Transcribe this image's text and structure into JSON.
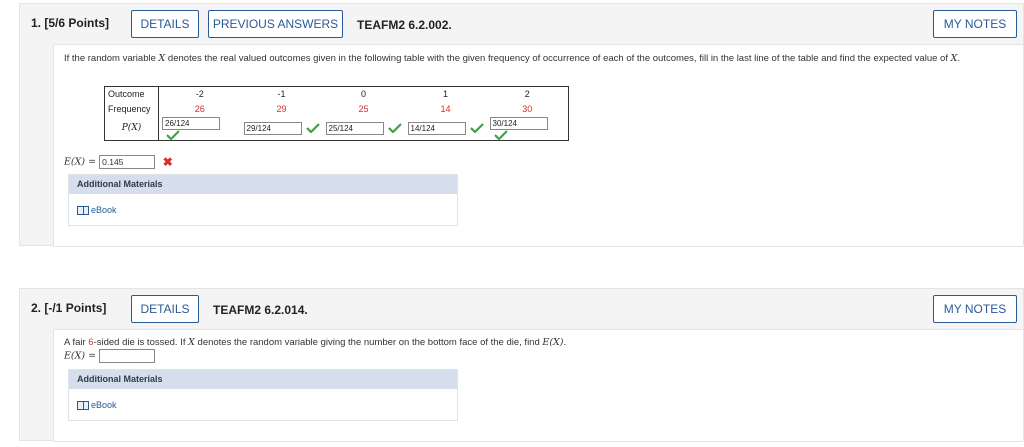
{
  "q1": {
    "number": "1.",
    "points": "[5/6 Points]",
    "details_label": "DETAILS",
    "prev_answers_label": "PREVIOUS ANSWERS",
    "code": "TEAFM2 6.2.002.",
    "notes_label": "MY NOTES",
    "prompt_a": "If the random variable ",
    "prompt_var": "X",
    "prompt_b": " denotes the real valued outcomes given in the following table with the given frequency of occurrence of each of the outcomes, fill in the last line of the table and find the expected value of ",
    "prompt_c": "X",
    "prompt_end": ".",
    "table": {
      "row_labels": [
        "Outcome",
        "Frequency",
        "P(X)"
      ],
      "outcomes": [
        "-2",
        "-1",
        "0",
        "1",
        "2"
      ],
      "frequencies": [
        "26",
        "29",
        "25",
        "14",
        "30"
      ],
      "probabilities": [
        "26/124",
        "29/124",
        "25/124",
        "14/124",
        "30/124"
      ]
    },
    "ex_label": "E(X) = ",
    "ex_value": "0.145",
    "ex_wrong_icon": "✖",
    "additional_materials": "Additional Materials",
    "ebook_label": "eBook"
  },
  "q2": {
    "number": "2.",
    "points": "[-/1 Points]",
    "details_label": "DETAILS",
    "code": "TEAFM2 6.2.014.",
    "notes_label": "MY NOTES",
    "prompt_a": "A fair ",
    "prompt_num": "6",
    "prompt_b": "-sided die is tossed. If ",
    "prompt_var": "X",
    "prompt_c": " denotes the random variable giving the number on the bottom face of the die, find ",
    "prompt_ex": "E(X)",
    "prompt_end": ".",
    "ex_label": "E(X) = ",
    "ex_value": "",
    "additional_materials": "Additional Materials",
    "ebook_label": "eBook"
  },
  "colors": {
    "accent": "#2a5a96",
    "correct": "#43a047",
    "incorrect": "#d32f2f",
    "frequency_text": "#d32f2f",
    "materials_header": "#d6deec"
  }
}
